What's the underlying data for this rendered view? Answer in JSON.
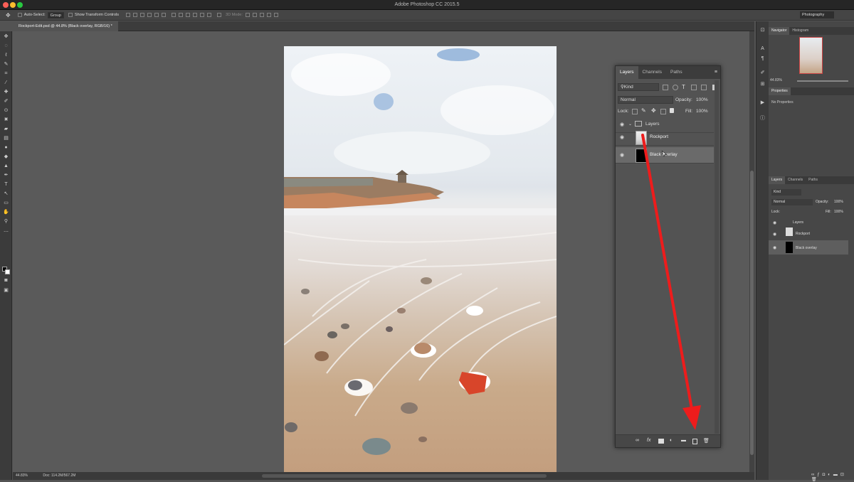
{
  "app": {
    "title": "Adobe Photoshop CC 2015.5"
  },
  "options_bar": {
    "auto_select_label": "Auto-Select:",
    "auto_select_value": "Group",
    "transform_label": "Show Transform Controls",
    "mode_3d_label": "3D Mode:",
    "workspace": "Photography"
  },
  "document": {
    "tab_title": "Rockport-Edit.psd @ 44.8% (Black overlay, RGB/16) *"
  },
  "status": {
    "zoom": "44.83%",
    "doc_size": "Doc: 114.2M/567.2M"
  },
  "navigator": {
    "tabs": [
      "Navigator",
      "Histogram"
    ],
    "zoom": "44.83%"
  },
  "properties": {
    "tab": "Properties",
    "empty_text": "No Properties"
  },
  "layers_panel": {
    "tabs": [
      "Layers",
      "Channels",
      "Paths"
    ],
    "filter_kind": "Kind",
    "blend_mode": "Normal",
    "opacity_label": "Opacity:",
    "opacity_value": "100%",
    "lock_label": "Lock:",
    "fill_label": "Fill:",
    "fill_value": "100%",
    "layers": [
      {
        "name": "Layers",
        "type": "group"
      },
      {
        "name": "Rockport",
        "type": "image"
      },
      {
        "name": "Black overlay",
        "type": "fill",
        "selected": true
      }
    ]
  },
  "colors": {
    "arrow": "#ee1c1c",
    "panel_bg": "#535353",
    "chrome": "#3b3b3b"
  },
  "icons": [
    "move-icon",
    "marquee-icon",
    "lasso-icon",
    "quick-select-icon",
    "crop-icon",
    "eyedropper-icon",
    "healing-icon",
    "brush-icon",
    "stamp-icon",
    "history-brush-icon",
    "eraser-icon",
    "gradient-icon",
    "blur-icon",
    "dodge-icon",
    "pen-icon",
    "type-icon",
    "path-select-icon",
    "shape-icon",
    "hand-icon",
    "zoom-icon",
    "eye-icon",
    "folder-icon",
    "link-icon",
    "fx-icon",
    "mask-icon",
    "adjustment-icon",
    "new-group-icon",
    "new-layer-icon",
    "trash-icon"
  ]
}
